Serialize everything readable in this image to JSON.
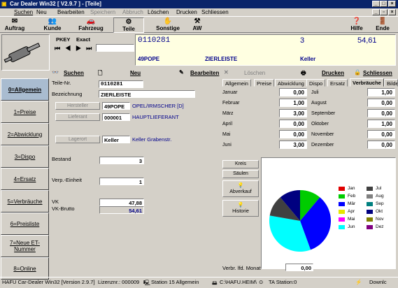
{
  "window": {
    "title": "Car Dealer Win32 [ V2.9.7 ] - [Teile]",
    "min": "_",
    "max": "□",
    "close": "×"
  },
  "menu": [
    "Suchen",
    "Neu",
    "Bearbeiten",
    "Speichern",
    "Abbruch",
    "Löschen",
    "Drucken",
    "Schliessen"
  ],
  "toolbar": [
    {
      "label": "Auftrag",
      "icon": "✉"
    },
    {
      "label": "Kunde",
      "icon": "👥"
    },
    {
      "label": "Fahrzeug",
      "icon": "🚗"
    },
    {
      "label": "Teile",
      "icon": "⚙"
    },
    {
      "label": "Sonstige",
      "icon": "✋"
    },
    {
      "label": "AW",
      "icon": "⚒"
    },
    {
      "label": "Hilfe",
      "icon": "❓"
    },
    {
      "label": "Ende",
      "icon": "🚪"
    }
  ],
  "header": {
    "pkey": "PKEY",
    "exact": "Exact",
    "part_no": "0110281",
    "qty": "3",
    "price": "54,61",
    "code": "49POPE",
    "name": "ZIERLEISTE",
    "location": "Keller"
  },
  "actions": {
    "suchen": "Suchen",
    "neu": "Neu",
    "bearbeiten": "Bearbeiten",
    "loeschen": "Löschen",
    "drucken": "Drucken",
    "schliessen": "Schliessen"
  },
  "nav": [
    "0=Allgemein",
    "1=Preise",
    "2=Abwicklung",
    "3=Dispo",
    "4=Ersatz",
    "5=Verbräuche",
    "6=Preisliste",
    "7=Neue ET-Nummer",
    "8=Online"
  ],
  "form": {
    "teile_nr_label": "Teile-Nr.",
    "teile_nr": "0110281",
    "bezeichnung_label": "Bezeichnung",
    "bezeichnung": "ZIERLEISTE",
    "hersteller_btn": "Hersteller",
    "hersteller_code": "49POPE",
    "hersteller_name": "OPEL/IRMSCHER [D]",
    "lieferant_btn": "Lieferant",
    "lieferant_code": "000001",
    "lieferant_name": "HAUPTLIEFERANT",
    "lagerort_btn": "Lagerort",
    "lagerort": "Keller",
    "lagerort_desc": "Keller Grabenstr.",
    "bestand_label": "Bestand",
    "bestand": "3",
    "verp_label": "Verp.-Einheit",
    "verp": "1",
    "vk_label": "VK",
    "vk": "47,88",
    "vk_brutto_label": "VK-Brutto",
    "vk_brutto": "54,61"
  },
  "tabs": [
    "Allgemein",
    "Preise",
    "Abwicklung",
    "Dispo",
    "Ersatz",
    "Verbräuche",
    "Bilder"
  ],
  "months_left": [
    {
      "m": "Januar",
      "v": "0,00"
    },
    {
      "m": "Februar",
      "v": "1,00"
    },
    {
      "m": "März",
      "v": "3,00"
    },
    {
      "m": "April",
      "v": "0,00"
    },
    {
      "m": "Mai",
      "v": "0,00"
    },
    {
      "m": "Juni",
      "v": "3,00"
    }
  ],
  "months_right": [
    {
      "m": "Juli",
      "v": "1,00"
    },
    {
      "m": "August",
      "v": "0,00"
    },
    {
      "m": "September",
      "v": "0,00"
    },
    {
      "m": "Oktober",
      "v": "1,00"
    },
    {
      "m": "November",
      "v": "0,00"
    },
    {
      "m": "Dezember",
      "v": "0,00"
    }
  ],
  "chart_buttons": [
    "Kreis",
    "Säulen",
    "Abverkauf",
    "Historie"
  ],
  "verbr": {
    "label": "Verbr. lfd. Monat",
    "value": "0,00"
  },
  "chart_data": {
    "type": "pie",
    "categories": [
      "Jan",
      "Feb",
      "Mär",
      "Apr",
      "Mai",
      "Jun",
      "Jul",
      "Aug",
      "Sep",
      "Okt",
      "Nov",
      "Dez"
    ],
    "values": [
      0,
      1,
      3,
      0,
      0,
      3,
      1,
      0,
      0,
      1,
      0,
      0
    ],
    "colors": [
      "#e00000",
      "#00cc00",
      "#0000ff",
      "#e6e600",
      "#ff00ff",
      "#00ffff",
      "#404040",
      "#808080",
      "#008080",
      "#000080",
      "#808000",
      "#800080"
    ],
    "legend_position": "right"
  },
  "status": {
    "version": "HAFU Car-Dealer Win32 [Version 2.9.7]",
    "lizenz": "Lizenznr.: 000009",
    "station": "Station 15 Allgemein",
    "path": "C:\\HAFU.HEIM\\",
    "ta": "TA Station:0",
    "down": "Downlc"
  }
}
